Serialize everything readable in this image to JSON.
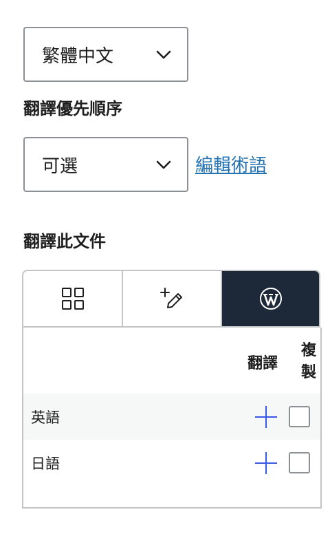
{
  "language_select": {
    "value": "繁體中文",
    "icon": "chevron-down-icon"
  },
  "priority": {
    "label": "翻譯優先順序",
    "value": "可選",
    "icon": "chevron-down-icon"
  },
  "glossary_link": "編輯術語",
  "translate_section": {
    "label": "翻譯此文件",
    "tabs": [
      {
        "icon": "grid-icon",
        "active": false
      },
      {
        "icon": "pencil-plus-icon",
        "active": false
      },
      {
        "icon": "wordpress-icon",
        "active": true
      }
    ],
    "table": {
      "col_translate": "翻譯",
      "col_duplicate": "複製",
      "rows": [
        {
          "language": "英語",
          "translate_icon": "plus-icon",
          "duplicate_checked": false
        },
        {
          "language": "日語",
          "translate_icon": "plus-icon",
          "duplicate_checked": false
        }
      ]
    }
  },
  "colors": {
    "accent": "#3858e9",
    "link": "#2271b1",
    "active_tab": "#1d2838",
    "border": "#c3c4c7"
  }
}
